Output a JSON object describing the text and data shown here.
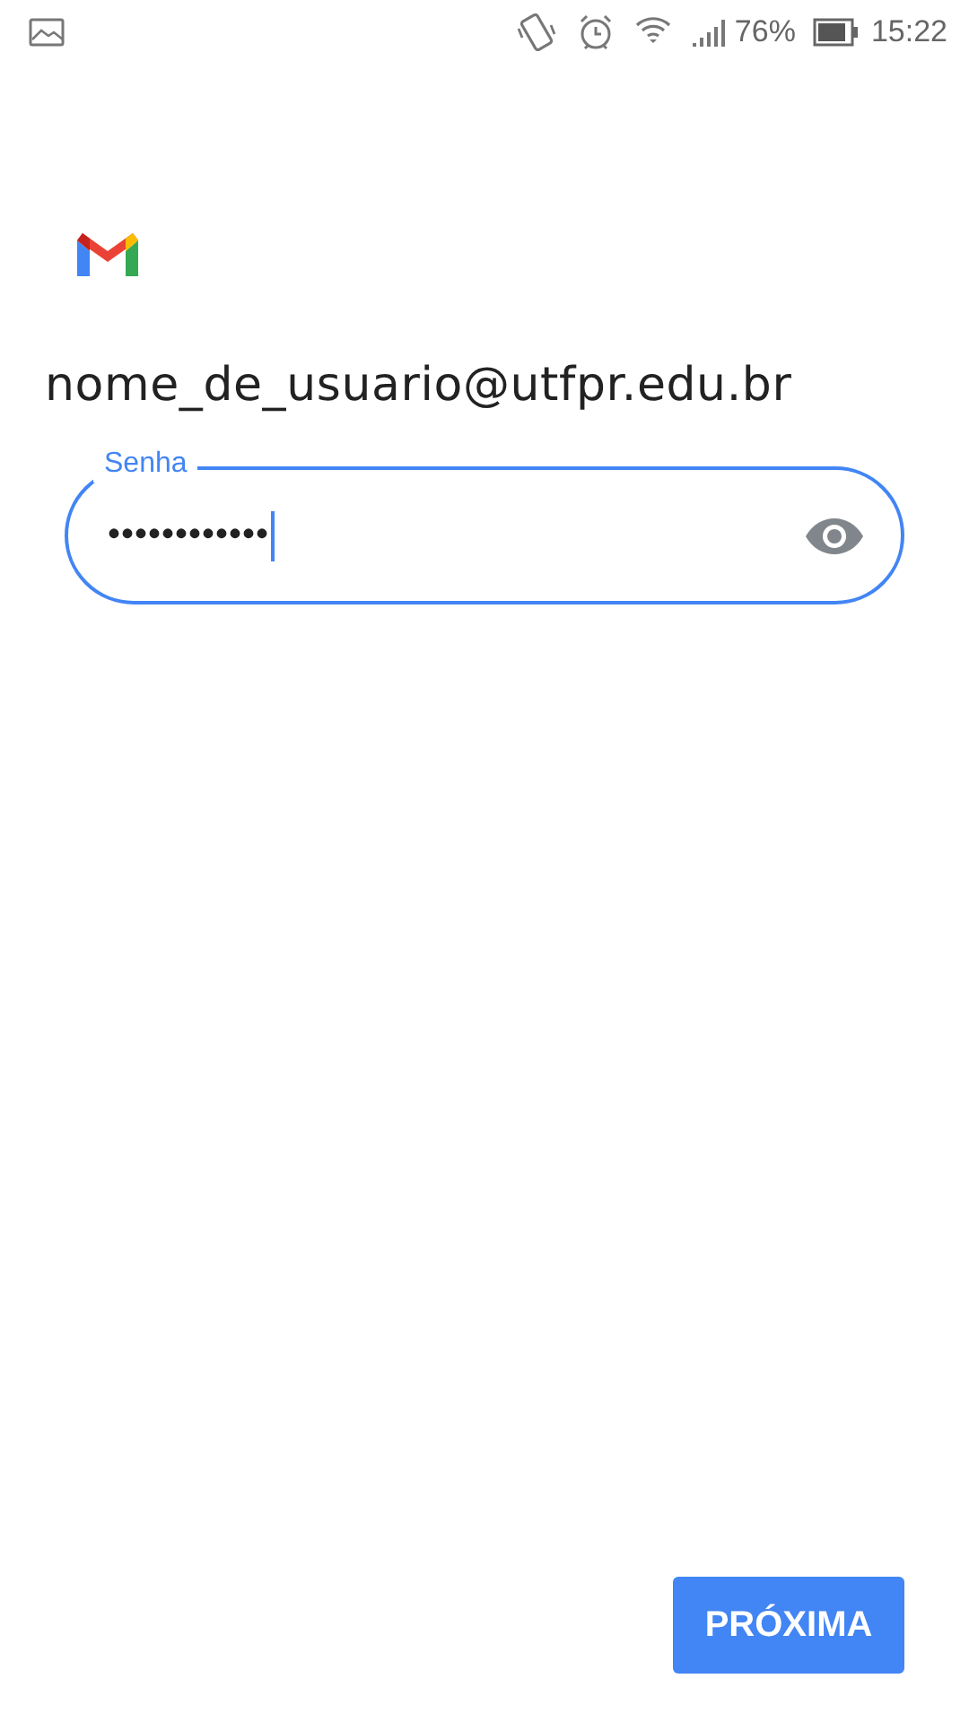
{
  "status_bar": {
    "battery": "76%",
    "time": "15:22"
  },
  "account": {
    "email": "nome_de_usuario@utfpr.edu.br"
  },
  "password_field": {
    "label": "Senha",
    "value": "••••••••••••",
    "focused": true
  },
  "next_button": {
    "label": "PRÓXIMA"
  }
}
